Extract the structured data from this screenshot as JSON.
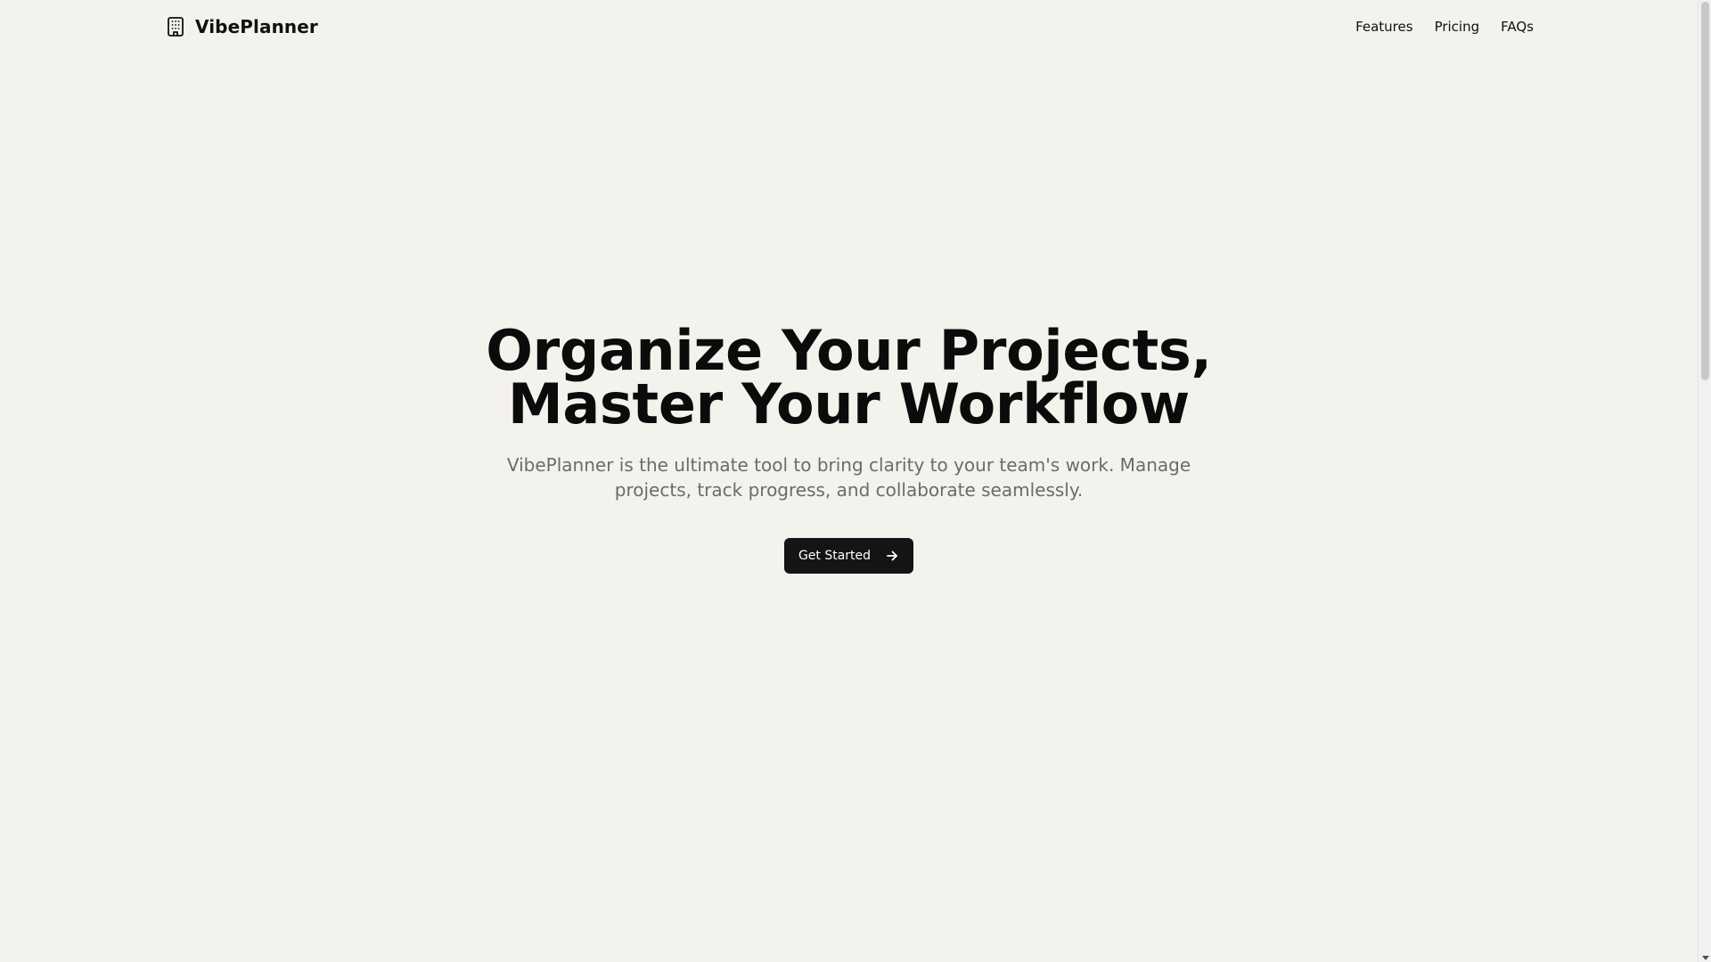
{
  "header": {
    "brand_name": "VibePlanner",
    "brand_icon": "building-icon",
    "nav": [
      {
        "label": "Features"
      },
      {
        "label": "Pricing"
      },
      {
        "label": "FAQs"
      }
    ]
  },
  "hero": {
    "title_line_1": "Organize Your Projects,",
    "title_line_2": "Master Your Workflow",
    "subtitle": "VibePlanner is the ultimate tool to bring clarity to your team's work. Manage projects, track progress, and collaborate seamlessly.",
    "cta_label": "Get Started",
    "cta_icon": "arrow-right-icon"
  },
  "colors": {
    "background": "#f4f2ec",
    "text": "#111111",
    "muted_text": "#6b6b6b",
    "button_bg": "#141414",
    "button_text": "#ffffff"
  }
}
